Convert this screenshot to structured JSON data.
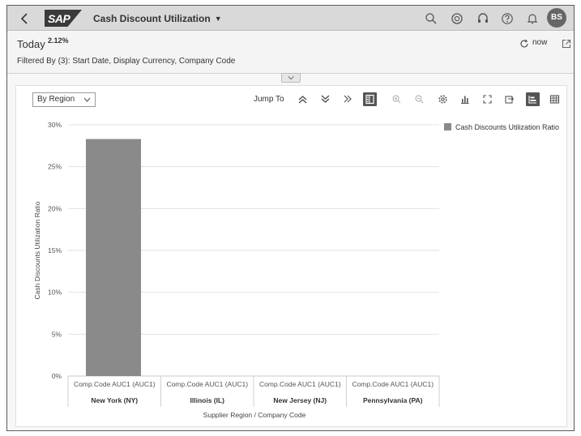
{
  "shell": {
    "logo": "SAP",
    "app_title": "Cash Discount Utilization",
    "avatar_initials": "BS",
    "icons": [
      "search-icon",
      "copilot-icon",
      "headset-icon",
      "help-icon",
      "notification-icon"
    ]
  },
  "header": {
    "today_label": "Today",
    "today_value": "2.12%",
    "filtered_by": "Filtered By (3): Start Date, Display Currency, Company Code",
    "refresh_label": "now"
  },
  "toolbar": {
    "view_select": "By Region",
    "jump_to": "Jump To"
  },
  "chart_data": {
    "type": "bar",
    "categories": [
      {
        "sub": "Comp.Code AUC1 (AUC1)",
        "group": "New York (NY)"
      },
      {
        "sub": "Comp.Code AUC1 (AUC1)",
        "group": "Illinois (IL)"
      },
      {
        "sub": "Comp.Code AUC1 (AUC1)",
        "group": "New Jersey (NJ)"
      },
      {
        "sub": "Comp.Code AUC1 (AUC1)",
        "group": "Pennsylvania (PA)"
      }
    ],
    "series": [
      {
        "name": "Cash Discounts Utilization Ratio",
        "values": [
          28.3,
          0,
          0,
          0
        ],
        "color": "#8a8a8a"
      }
    ],
    "ylabel": "Cash Discounts Utilization Ratio",
    "xlabel": "Supplier Region / Company Code",
    "yticks": [
      "0%",
      "5%",
      "10%",
      "15%",
      "20%",
      "25%",
      "30%"
    ],
    "ylim": [
      0,
      30
    ],
    "grid": true,
    "legend_position": "top-right"
  }
}
